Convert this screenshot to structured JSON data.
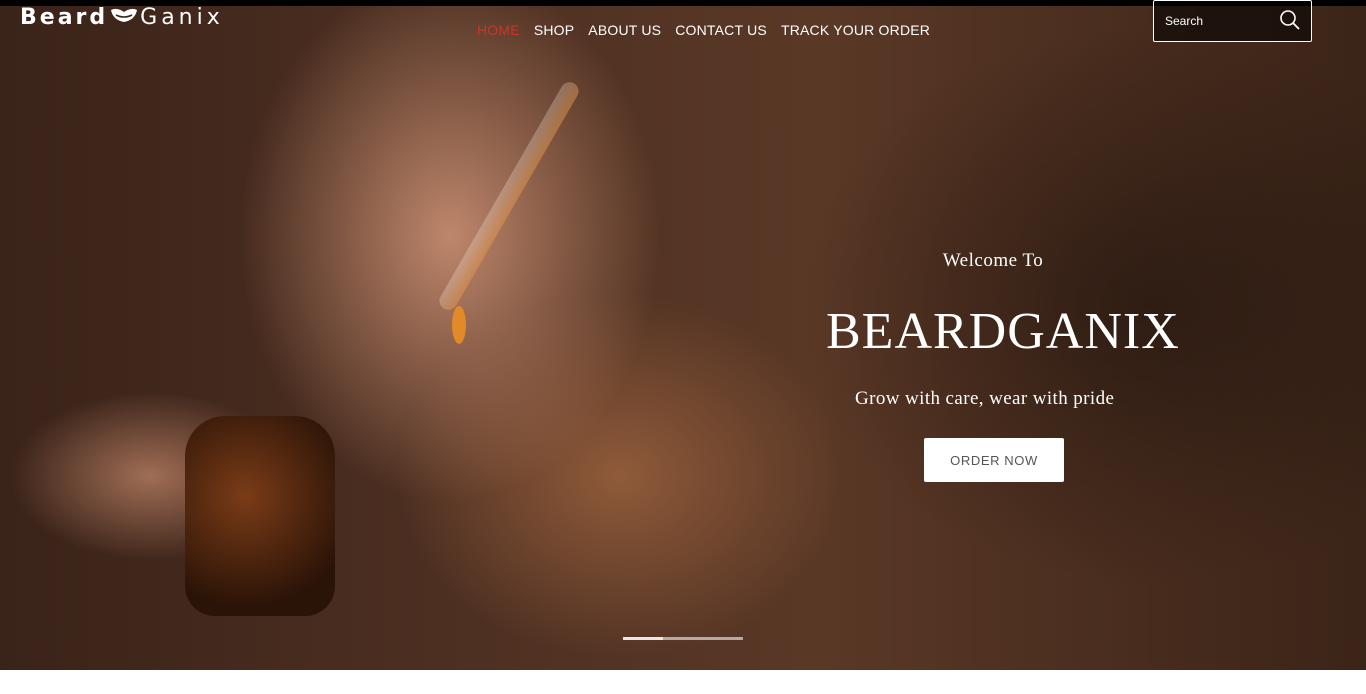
{
  "brand_logo": {
    "part1": "Beard",
    "part2": "Ganix"
  },
  "nav": {
    "items": [
      {
        "label": "HOME",
        "active": true
      },
      {
        "label": "SHOP",
        "active": false
      },
      {
        "label": "ABOUT US",
        "active": false
      },
      {
        "label": "CONTACT US",
        "active": false
      },
      {
        "label": "TRACK YOUR ORDER",
        "active": false
      }
    ]
  },
  "search": {
    "placeholder": "Search",
    "icon": "search-icon"
  },
  "hero": {
    "welcome": "Welcome To",
    "title": "BEARDGANIX",
    "tagline": "Grow with care, wear with pride",
    "cta_label": "ORDER NOW"
  },
  "slider": {
    "slides": 3,
    "active_index": 0
  },
  "colors": {
    "active_nav": "#c0392b",
    "text": "#ffffff"
  }
}
